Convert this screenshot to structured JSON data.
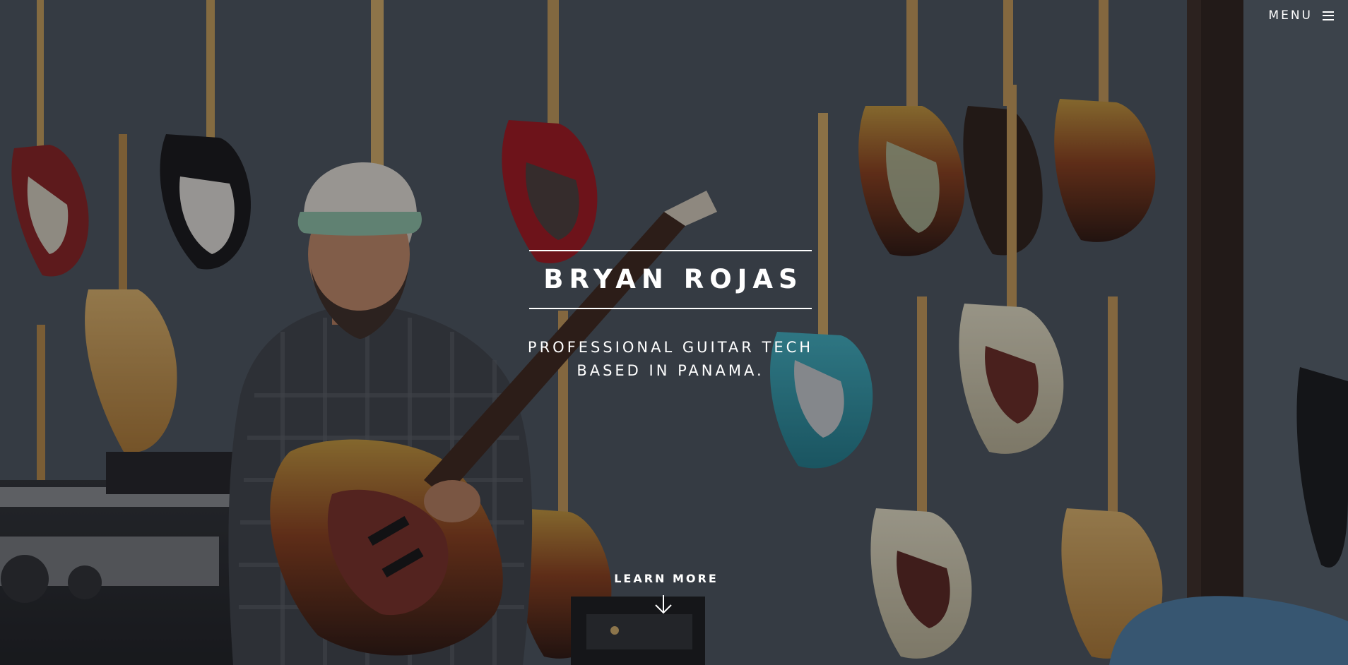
{
  "header": {
    "menu_label": "MENU",
    "menu_icon": "hamburger-icon"
  },
  "hero": {
    "title": "BRYAN ROJAS",
    "tagline_line1": "PROFESSIONAL GUITAR TECH",
    "tagline_line2": "BASED IN PANAMA.",
    "cta_label": "LEARN MORE",
    "cta_icon": "arrow-down-icon",
    "background_image": "photo-guitar-tech-with-wall-of-guitars"
  },
  "colors": {
    "text": "#ffffff",
    "wall": "#4b5560",
    "overlay": "#14161a"
  }
}
